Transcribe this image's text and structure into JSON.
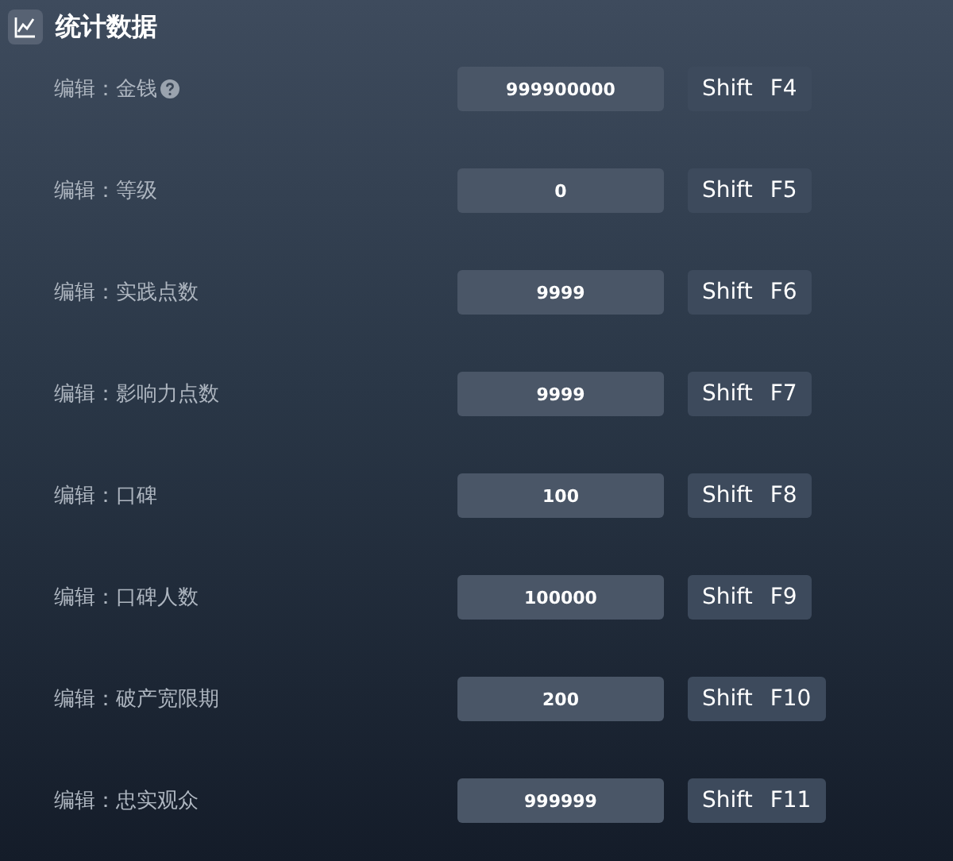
{
  "section": {
    "title": "统计数据"
  },
  "rows": [
    {
      "label": "编辑：金钱",
      "help": true,
      "value": "999900000",
      "keys": [
        "Shift",
        "F4"
      ]
    },
    {
      "label": "编辑：等级",
      "help": false,
      "value": "0",
      "keys": [
        "Shift",
        "F5"
      ]
    },
    {
      "label": "编辑：实践点数",
      "help": false,
      "value": "9999",
      "keys": [
        "Shift",
        "F6"
      ]
    },
    {
      "label": "编辑：影响力点数",
      "help": false,
      "value": "9999",
      "keys": [
        "Shift",
        "F7"
      ]
    },
    {
      "label": "编辑：口碑",
      "help": false,
      "value": "100",
      "keys": [
        "Shift",
        "F8"
      ]
    },
    {
      "label": "编辑：口碑人数",
      "help": false,
      "value": "100000",
      "keys": [
        "Shift",
        "F9"
      ]
    },
    {
      "label": "编辑：破产宽限期",
      "help": false,
      "value": "200",
      "keys": [
        "Shift",
        "F10"
      ]
    },
    {
      "label": "编辑：忠实观众",
      "help": false,
      "value": "999999",
      "keys": [
        "Shift",
        "F11"
      ]
    }
  ]
}
